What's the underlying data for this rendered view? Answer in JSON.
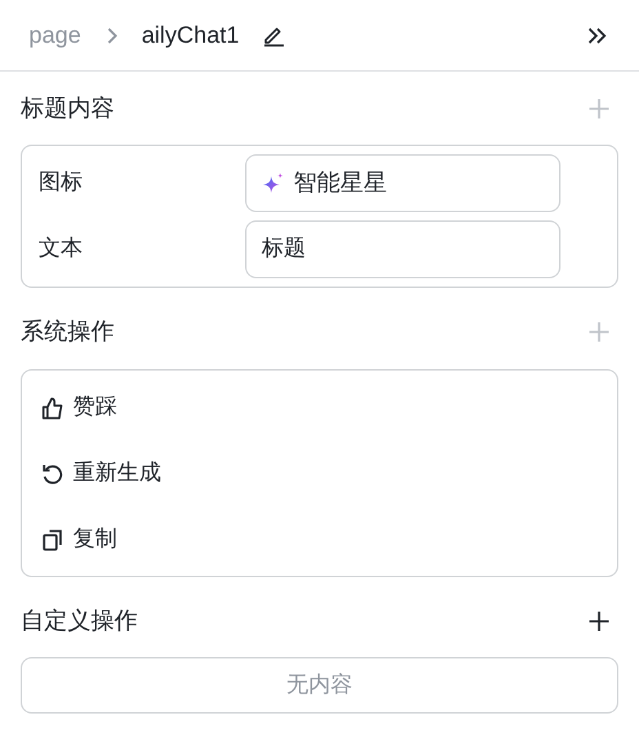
{
  "breadcrumb": {
    "parent": "page",
    "current": "ailyChat1"
  },
  "sections": [
    {
      "title": "标题内容",
      "add_disabled": true,
      "kind": "fields",
      "fields": [
        {
          "label": "图标",
          "kind": "icon-select",
          "value": "智能星星"
        },
        {
          "label": "文本",
          "kind": "text",
          "value": "标题"
        }
      ]
    },
    {
      "title": "系统操作",
      "add_disabled": true,
      "kind": "actions",
      "actions": [
        {
          "label": "赞踩",
          "kind": "thumb"
        },
        {
          "label": "重新生成",
          "kind": "regenerate"
        },
        {
          "label": "复制",
          "kind": "copy"
        }
      ]
    },
    {
      "title": "自定义操作",
      "add_disabled": false,
      "kind": "empty",
      "empty_text": "无内容"
    }
  ]
}
